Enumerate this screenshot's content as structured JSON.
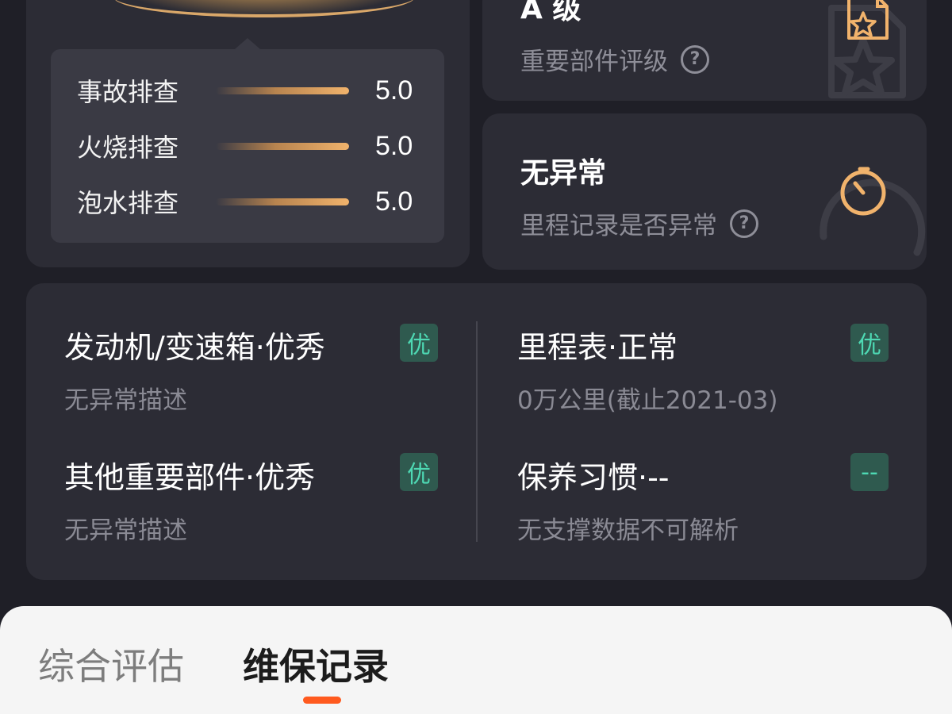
{
  "score_card": {
    "rows": [
      {
        "label": "事故排查",
        "value": "5.0"
      },
      {
        "label": "火烧排查",
        "value": "5.0"
      },
      {
        "label": "泡水排查",
        "value": "5.0"
      }
    ]
  },
  "grade_card": {
    "title": "A 级",
    "subtitle": "重要部件评级",
    "help_icon": "?"
  },
  "anomaly_card": {
    "title": "无异常",
    "subtitle": "里程记录是否异常",
    "help_icon": "?"
  },
  "details": {
    "left": [
      {
        "title": "发动机/变速箱·优秀",
        "desc": "无异常描述",
        "tag": "优"
      },
      {
        "title": "其他重要部件·优秀",
        "desc": "无异常描述",
        "tag": "优"
      }
    ],
    "right": [
      {
        "title": "里程表·正常",
        "desc": "0万公里(截止2021-03)",
        "tag": "优"
      },
      {
        "title": "保养习惯·--",
        "desc": "无支撑数据不可解析",
        "tag": "--"
      }
    ]
  },
  "tabs": {
    "overview": "综合评估",
    "maintenance": "维保记录"
  },
  "colors": {
    "background": "#1f1f27",
    "card": "#2c2c35",
    "accent_gold": "#f1b36c",
    "tag_green": "#4ed8b3",
    "tab_indicator": "#ff5a1f"
  }
}
